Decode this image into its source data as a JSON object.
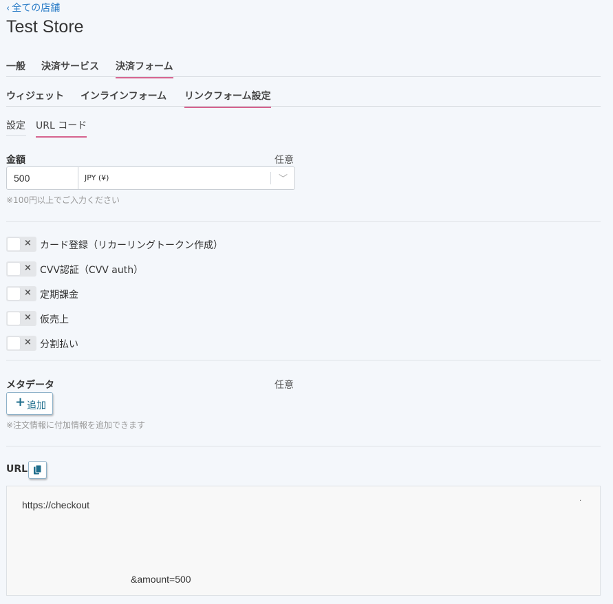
{
  "header": {
    "back_label": "全ての店舗",
    "title": "Test Store"
  },
  "tabs_primary": [
    {
      "label": "一般",
      "active": false
    },
    {
      "label": "決済サービス",
      "active": false
    },
    {
      "label": "決済フォーム",
      "active": true
    }
  ],
  "tabs_secondary": [
    {
      "label": "ウィジェット",
      "active": false
    },
    {
      "label": "インラインフォーム",
      "active": false
    },
    {
      "label": "リンクフォーム設定",
      "active": true
    }
  ],
  "tabs_tertiary": [
    {
      "label": "設定",
      "active": false
    },
    {
      "label": "URL コード",
      "active": true
    }
  ],
  "amount": {
    "label": "金額",
    "optional": "任意",
    "value": "500",
    "currency": "JPY (¥)",
    "hint": "※100円以上でご入力ください"
  },
  "toggles": [
    {
      "label": "カード登録（リカーリングトークン作成）",
      "on": false
    },
    {
      "label": "CVV認証（CVV auth）",
      "on": false
    },
    {
      "label": "定期課金",
      "on": false
    },
    {
      "label": "仮売上",
      "on": false
    },
    {
      "label": "分割払い",
      "on": false
    }
  ],
  "toggle_off_glyph": "×",
  "metadata": {
    "label": "メタデータ",
    "optional": "任意",
    "add_label": "追加",
    "hint": "※注文情報に付加情報を追加できます"
  },
  "url": {
    "label": "URL",
    "line1": "https://checkout",
    "line1_tail": "·",
    "line2": "&amount=500"
  },
  "colors": {
    "accent_underline": "#d6638f",
    "link": "#2a7cc7",
    "button_text": "#1f6e8c",
    "background": "#f4f7fb"
  },
  "icons": {
    "back": "chevron-left-icon",
    "currency": "chevron-down-icon",
    "add": "plus-icon",
    "copy": "copy-icon"
  }
}
